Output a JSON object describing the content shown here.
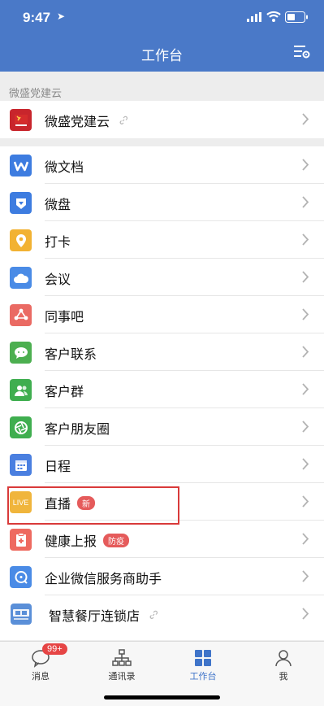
{
  "status": {
    "time": "9:47"
  },
  "header": {
    "title": "工作台"
  },
  "section": {
    "label": "微盛党建云"
  },
  "group1": [
    {
      "label": "微盛党建云",
      "icon": "party-flag-icon",
      "color": "#c8252c"
    }
  ],
  "group2": [
    {
      "label": "微文档",
      "icon": "doc-icon",
      "color": "#3d7ce0"
    },
    {
      "label": "微盘",
      "icon": "drive-icon",
      "color": "#3d7ce0"
    },
    {
      "label": "打卡",
      "icon": "location-pin-icon",
      "color": "#f2b232"
    },
    {
      "label": "会议",
      "icon": "cloud-icon",
      "color": "#4a8be6"
    },
    {
      "label": "同事吧",
      "icon": "share-icon",
      "color": "#ea6a63"
    },
    {
      "label": "客户联系",
      "icon": "chat-icon",
      "color": "#4caf50"
    },
    {
      "label": "客户群",
      "icon": "group-icon",
      "color": "#3fae4f"
    },
    {
      "label": "客户朋友圈",
      "icon": "shutter-icon",
      "color": "#3fae4f"
    },
    {
      "label": "日程",
      "icon": "calendar-icon",
      "color": "#4a7fe0"
    },
    {
      "label": "直播",
      "badge": "新",
      "icon": "live-icon",
      "color": "#f0b53c"
    },
    {
      "label": "健康上报",
      "badge": "防疫",
      "icon": "health-report-icon",
      "color": "#ee6a60"
    },
    {
      "label": "企业微信服务商助手",
      "icon": "assistant-icon",
      "color": "#4a8be6"
    },
    {
      "label": "智慧餐厅连锁店",
      "icon": "weisheng-logo-icon",
      "color": "#5a8fd8"
    }
  ],
  "tabs": [
    {
      "label": "消息",
      "badge": "99+"
    },
    {
      "label": "通讯录"
    },
    {
      "label": "工作台"
    },
    {
      "label": "我"
    }
  ]
}
